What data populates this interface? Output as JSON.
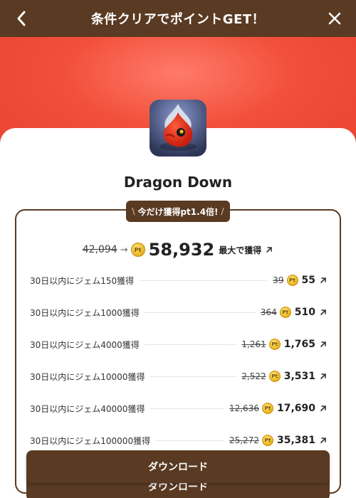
{
  "header": {
    "title": "条件クリアでポイントGET！"
  },
  "app": {
    "name": "Dragon Down"
  },
  "badge": {
    "text": "今だけ獲得pt1.4倍!",
    "slash_left": "\\",
    "slash_right": "/"
  },
  "total": {
    "old_value": "42,094",
    "arrow": "→",
    "new_value": "58,932",
    "suffix": "最大で獲得"
  },
  "coin_label": "Pt",
  "rewards": [
    {
      "label": "30日以内にジェム150獲得",
      "old": "39",
      "new": "55"
    },
    {
      "label": "30日以内にジェム1000獲得",
      "old": "364",
      "new": "510"
    },
    {
      "label": "30日以内にジェム4000獲得",
      "old": "1,261",
      "new": "1,765"
    },
    {
      "label": "30日以内にジェム10000獲得",
      "old": "2,522",
      "new": "3,531"
    },
    {
      "label": "30日以内にジェム40000獲得",
      "old": "12,636",
      "new": "17,690"
    },
    {
      "label": "30日以内にジェム100000獲得",
      "old": "25,272",
      "new": "35,381"
    }
  ],
  "buttons": {
    "download_primary": "ダウンロード",
    "download_secondary": "ダウンロード"
  },
  "colors": {
    "brand_brown": "#5a3a22",
    "hero_red": "#f2503b",
    "coin_gold": "#e8b21f"
  }
}
